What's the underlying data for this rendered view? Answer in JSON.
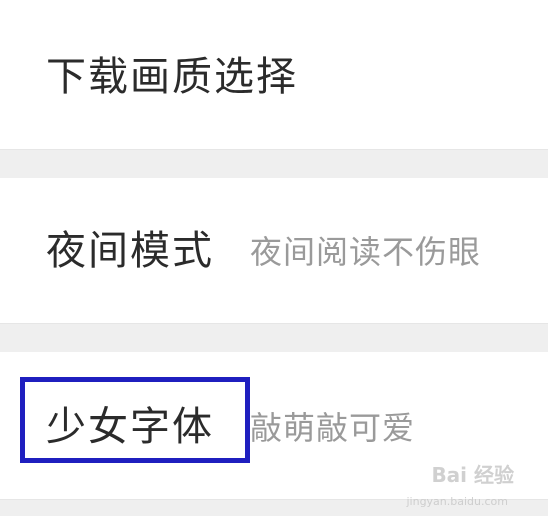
{
  "settings": {
    "download_quality": {
      "label": "下载画质选择"
    },
    "night_mode": {
      "label": "夜间模式",
      "subtitle": "夜间阅读不伤眼"
    },
    "girl_font": {
      "label": "少女字体",
      "subtitle": "敲萌敲可爱"
    }
  },
  "watermark": {
    "brand": "Bai 经验",
    "url": "jingyan.baidu.com"
  },
  "colors": {
    "highlight": "#1f1fbf"
  }
}
